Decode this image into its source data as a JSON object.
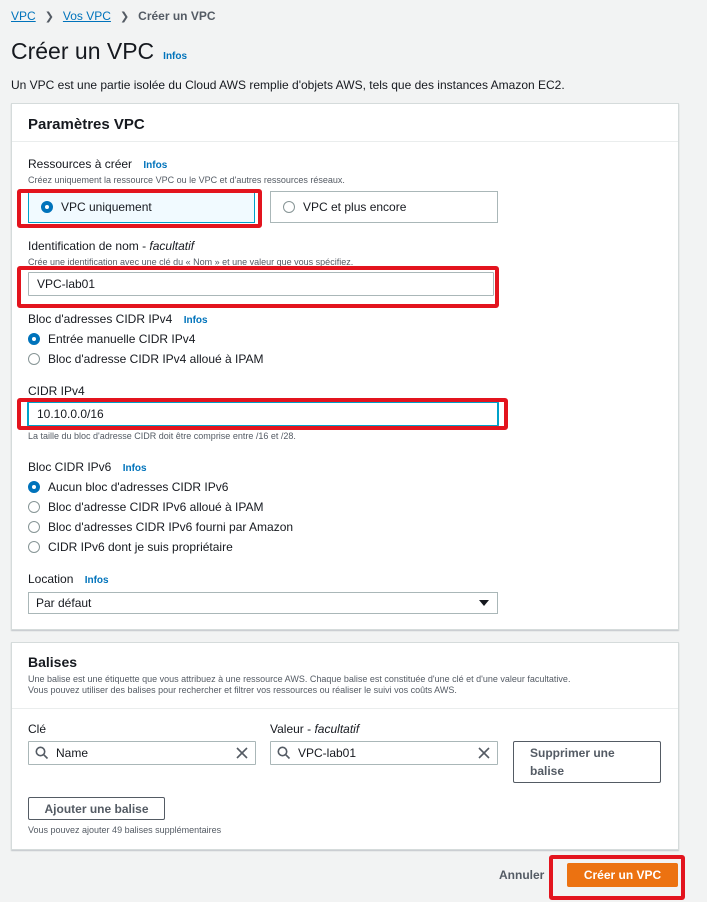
{
  "breadcrumb": {
    "item1": "VPC",
    "item2": "Vos VPC",
    "current": "Créer un VPC"
  },
  "page": {
    "title": "Créer un VPC",
    "info": "Infos",
    "description": "Un VPC est une partie isolée du Cloud AWS remplie d'objets AWS, tels que des instances Amazon EC2."
  },
  "vpc_settings": {
    "title": "Paramètres VPC",
    "resources": {
      "label": "Ressources à créer",
      "info": "Infos",
      "hint": "Créez uniquement la ressource VPC ou le VPC et d'autres ressources réseaux.",
      "option_vpc_only": "VPC uniquement",
      "option_vpc_more": "VPC et plus encore",
      "selected": "VPC uniquement"
    },
    "name_tag": {
      "label": "Identification de nom - ",
      "label_optional": "facultatif",
      "hint": "Crée une identification avec une clé du « Nom » et une valeur que vous spécifiez.",
      "value": "VPC-lab01"
    },
    "ipv4_block": {
      "label": "Bloc d'adresses CIDR IPv4",
      "info": "Infos",
      "option_manual": "Entrée manuelle CIDR IPv4",
      "option_ipam": "Bloc d'adresse CIDR IPv4 alloué à IPAM",
      "selected": "Entrée manuelle CIDR IPv4"
    },
    "ipv4_cidr": {
      "label": "CIDR IPv4",
      "value": "10.10.0.0/16",
      "hint": "La taille du bloc d'adresse CIDR doit être comprise entre /16 et /28."
    },
    "ipv6_block": {
      "label": "Bloc CIDR IPv6",
      "info": "Infos",
      "option_none": "Aucun bloc d'adresses CIDR IPv6",
      "option_ipam": "Bloc d'adresse CIDR IPv6 alloué à IPAM",
      "option_amazon": "Bloc d'adresses CIDR IPv6 fourni par Amazon",
      "option_own": "CIDR IPv6 dont je suis propriétaire",
      "selected": "Aucun bloc d'adresses CIDR IPv6"
    },
    "location": {
      "label": "Location",
      "info": "Infos",
      "value": "Par défaut"
    }
  },
  "tags": {
    "title": "Balises",
    "description_line1": "Une balise est une étiquette que vous attribuez à une ressource AWS. Chaque balise est constituée d'une clé et d'une valeur facultative.",
    "description_line2": "Vous pouvez utiliser des balises pour rechercher et filtrer vos ressources ou réaliser le suivi vos coûts AWS.",
    "key_label": "Clé",
    "value_label": "Valeur - ",
    "value_label_optional": "facultatif",
    "key_value": "Name",
    "value_value": "VPC-lab01",
    "remove_button_line1": "Supprimer une",
    "remove_button_line2": "balise",
    "add_button": "Ajouter une balise",
    "remaining": "Vous pouvez ajouter 49 balises supplémentaires"
  },
  "footer": {
    "cancel": "Annuler",
    "create": "Créer un VPC"
  },
  "colors": {
    "primary": "#ec7211",
    "link": "#0073bb",
    "highlight": "#e3141e"
  }
}
